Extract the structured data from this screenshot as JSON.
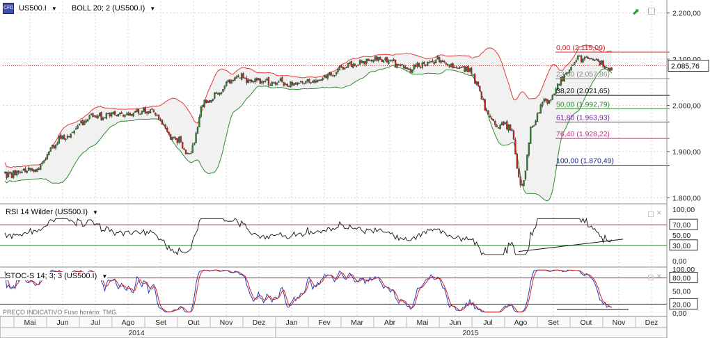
{
  "header": {
    "symbol_label": "US500.I",
    "indicator_label": "BOLL 20; 2 (US500.I)"
  },
  "rsi_panel": {
    "label": "RSI 14 Wilder (US500.I)"
  },
  "stoch_panel": {
    "label": "STOC-S 14; 3; 3 (US500.I)"
  },
  "footer_note": "PREÇO INDICATIVO   Fuso horário: TMG",
  "current_price_label": "2.085,76",
  "months": [
    "Mai",
    "Jun",
    "Jul",
    "Ago",
    "Set",
    "Out",
    "Nov",
    "Dez",
    "Jan",
    "Fev",
    "Mar",
    "Abr",
    "Mai",
    "Jun",
    "Jul",
    "Ago",
    "Set",
    "Out",
    "Nov",
    "Dez"
  ],
  "years": [
    "2014",
    "2015"
  ],
  "colors": {
    "up": "#2e7d32",
    "down": "#c62828",
    "upper_band": "#e53935",
    "lower_band": "#2e8b2e",
    "rsi_line": "#111111",
    "stoch_k": "#1f3fbf",
    "stoch_d": "#d62020"
  },
  "chart_data": [
    {
      "type": "candlestick",
      "title": "US500.I",
      "series": [
        {
          "name": "BOLL 20; 2 (US500.I)"
        }
      ],
      "y_ticks": [
        "2.200,00",
        "2.100,00",
        "2.000,00",
        "1.900,00",
        "1.800,00"
      ],
      "ylim": [
        1790,
        2225
      ],
      "current_price": 2085.76,
      "monthly_anchors": [
        1850,
        1860,
        1930,
        1975,
        1980,
        1985,
        1925,
        2010,
        2060,
        2050,
        2045,
        2060,
        2090,
        2100,
        2080,
        2095,
        2075,
        1960,
        1935,
        2045,
        2105,
        2080
      ],
      "fibonacci_levels": [
        {
          "label": "0,00 (2.115,09)",
          "value": 2115.09,
          "color": "#d62020"
        },
        {
          "label": "23,60 (2.057,86)",
          "value": 2057.86,
          "color": "#888888"
        },
        {
          "label": "38,20 (2.021,65)",
          "value": 2021.65,
          "color": "#111111"
        },
        {
          "label": "50,00 (1.992,79)",
          "value": 1992.79,
          "color": "#2e8b2e"
        },
        {
          "label": "61,80 (1.963,93)",
          "value": 1963.93,
          "color": "#7b1fa2"
        },
        {
          "label": "76,40 (1.928,22)",
          "value": 1928.22,
          "color": "#d81b8f"
        },
        {
          "label": "100,00 (1.870,49)",
          "value": 1870.49,
          "color": "#1a237e"
        }
      ]
    },
    {
      "type": "line",
      "title": "RSI 14 Wilder (US500.I)",
      "ylim": [
        0,
        100
      ],
      "y_ticks": [
        "100,00",
        "70,00",
        "50,00",
        "30,00",
        "0,00"
      ],
      "levels": [
        70,
        30
      ]
    },
    {
      "type": "line",
      "title": "STOC-S 14; 3; 3 (US500.I)",
      "ylim": [
        0,
        100
      ],
      "y_ticks": [
        "100,00",
        "80,00",
        "50,00",
        "20,00",
        "0,00"
      ],
      "levels": [
        80,
        20
      ]
    }
  ]
}
